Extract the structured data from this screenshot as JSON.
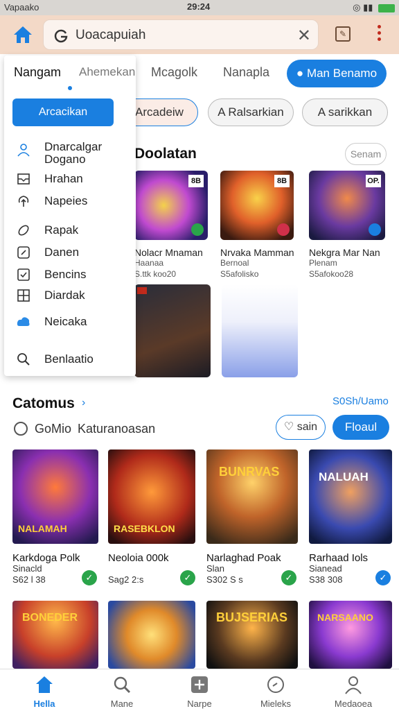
{
  "status_bar": {
    "carrier": "Vapaako",
    "time": "29:24"
  },
  "search": {
    "value": "Uoacapuiah"
  },
  "tabs": [
    {
      "label": "Mcagolk"
    },
    {
      "label": "Nanapla"
    }
  ],
  "login_button": "Man Benamo",
  "chips": [
    "Arcadeiw",
    "A Ralsarkian",
    "A sarikkan"
  ],
  "dropdown": {
    "tab_active": "Nangam",
    "tab_other": "Ahemekan",
    "primary_label": "Arcacikan",
    "items": [
      {
        "label": "Dnarcalgar",
        "label2": "Dogano",
        "icon": "person-icon"
      },
      {
        "label": "Hrahan",
        "icon": "inbox-icon"
      },
      {
        "label": "Napeies",
        "icon": "upload-icon"
      },
      {
        "label": "Rapak",
        "icon": "link-icon"
      },
      {
        "label": "Danen",
        "icon": "square-arrow-icon"
      },
      {
        "label": "Bencins",
        "icon": "check-box-icon"
      },
      {
        "label": "Diardak",
        "icon": "grid-icon"
      },
      {
        "label": "Neicaka",
        "icon": "cloud-icon"
      },
      {
        "label": "Benlaatio",
        "icon": "search-icon"
      }
    ]
  },
  "featured": {
    "title": "Doolatan",
    "more_label": "Senam",
    "cards": [
      {
        "title": "Nolacr Mnaman",
        "sub1": "Haanaa",
        "sub2": "S.ttk koo20",
        "tag": "8B"
      },
      {
        "title": "Nrvaka Mamman",
        "sub1": "Bernoal",
        "sub2": "S5afolisko",
        "tag": "8B"
      },
      {
        "title": "Nekgra Mar Nan",
        "sub1": "Plenam",
        "sub2": "S5afokoo28",
        "tag": "OP."
      }
    ]
  },
  "catalog": {
    "title": "Catomus",
    "see_all": "S0Sh/Uamo",
    "filter_1": "GoMio",
    "filter_2": "Katuranoasan",
    "save_label": "sain",
    "follow_label": "Floaul",
    "items": [
      {
        "art_text": "NALAMAH",
        "title": "Karkdoga Polk",
        "sub": "Sinacld",
        "meta": "S62 l 38",
        "check": "green"
      },
      {
        "art_text": "RASEBKLON",
        "title": "Neoloia 000k",
        "sub": "",
        "meta": "Sag2 2:s",
        "check": "green"
      },
      {
        "art_text": "BUNRVAS",
        "title": "Narlaghad Poak",
        "sub": "Slan",
        "meta": "S302 S s",
        "check": "green"
      },
      {
        "art_text": "NALUAH",
        "title": "Rarhaad Iols",
        "sub": "Sianead",
        "meta": "S38 308",
        "check": "blue"
      },
      {
        "art_text": "BONEDER",
        "title": "",
        "sub": "",
        "meta": "",
        "check": ""
      },
      {
        "art_text": "",
        "title": "",
        "sub": "",
        "meta": "",
        "check": ""
      },
      {
        "art_text": "BUJSERIAS",
        "title": "",
        "sub": "",
        "meta": "",
        "check": ""
      },
      {
        "art_text": "NARSAANO",
        "title": "",
        "sub": "",
        "meta": "",
        "check": ""
      }
    ]
  },
  "bottom_nav": [
    {
      "label": "Hella",
      "icon": "home-icon",
      "active": true
    },
    {
      "label": "Mane",
      "icon": "search-icon",
      "active": false
    },
    {
      "label": "Narpe",
      "icon": "plus-square-icon",
      "active": false
    },
    {
      "label": "Mieleks",
      "icon": "compass-icon",
      "active": false
    },
    {
      "label": "Medaoea",
      "icon": "profile-icon",
      "active": false
    }
  ],
  "colors": {
    "accent": "#1a7fe0",
    "top_bar": "#f3d9c7",
    "check_green": "#2aa44a"
  }
}
